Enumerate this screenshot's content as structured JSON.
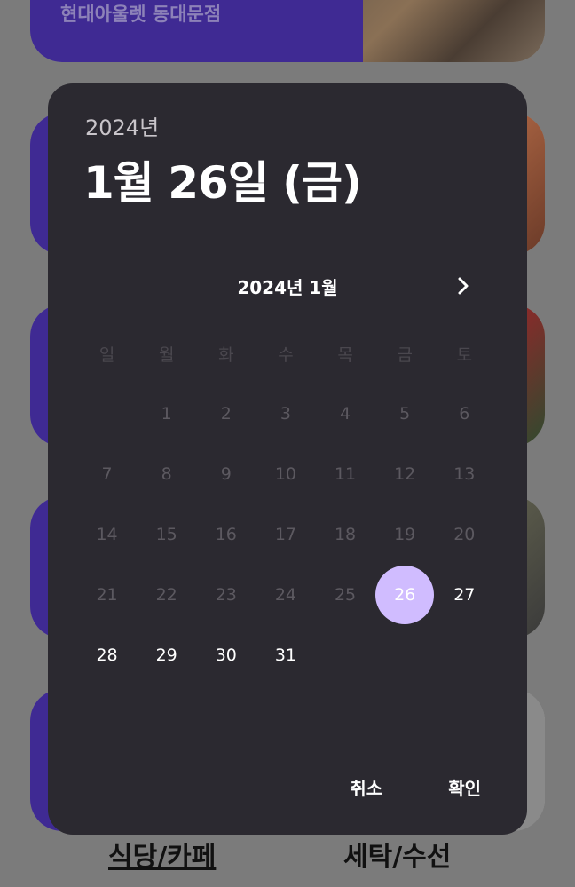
{
  "background": {
    "cards": [
      {
        "label": "현대아울렛 동대문점"
      },
      {
        "label": ""
      },
      {
        "label": ""
      },
      {
        "label": ""
      },
      {
        "label": ""
      }
    ],
    "bottom_tabs": [
      {
        "label": "식당/카페"
      },
      {
        "label": "세탁/수선"
      }
    ]
  },
  "dialog": {
    "year": "2024년",
    "selected_date": "1월 26일 (금)",
    "month_title": "2024년 1월",
    "weekdays": [
      "일",
      "월",
      "화",
      "수",
      "목",
      "금",
      "토"
    ],
    "weeks": [
      [
        "",
        "1",
        "2",
        "3",
        "4",
        "5",
        "6"
      ],
      [
        "7",
        "8",
        "9",
        "10",
        "11",
        "12",
        "13"
      ],
      [
        "14",
        "15",
        "16",
        "17",
        "18",
        "19",
        "20"
      ],
      [
        "21",
        "22",
        "23",
        "24",
        "25",
        "26",
        "27"
      ],
      [
        "28",
        "29",
        "30",
        "31",
        "",
        "",
        ""
      ]
    ],
    "selected_day": "26",
    "enabled_days": [
      "26",
      "27",
      "28",
      "29",
      "30",
      "31"
    ],
    "cancel_label": "취소",
    "confirm_label": "확인",
    "colors": {
      "surface": "#2b2930",
      "selected_circle": "#d0bcff",
      "brand_purple": "#3f2a93"
    }
  }
}
